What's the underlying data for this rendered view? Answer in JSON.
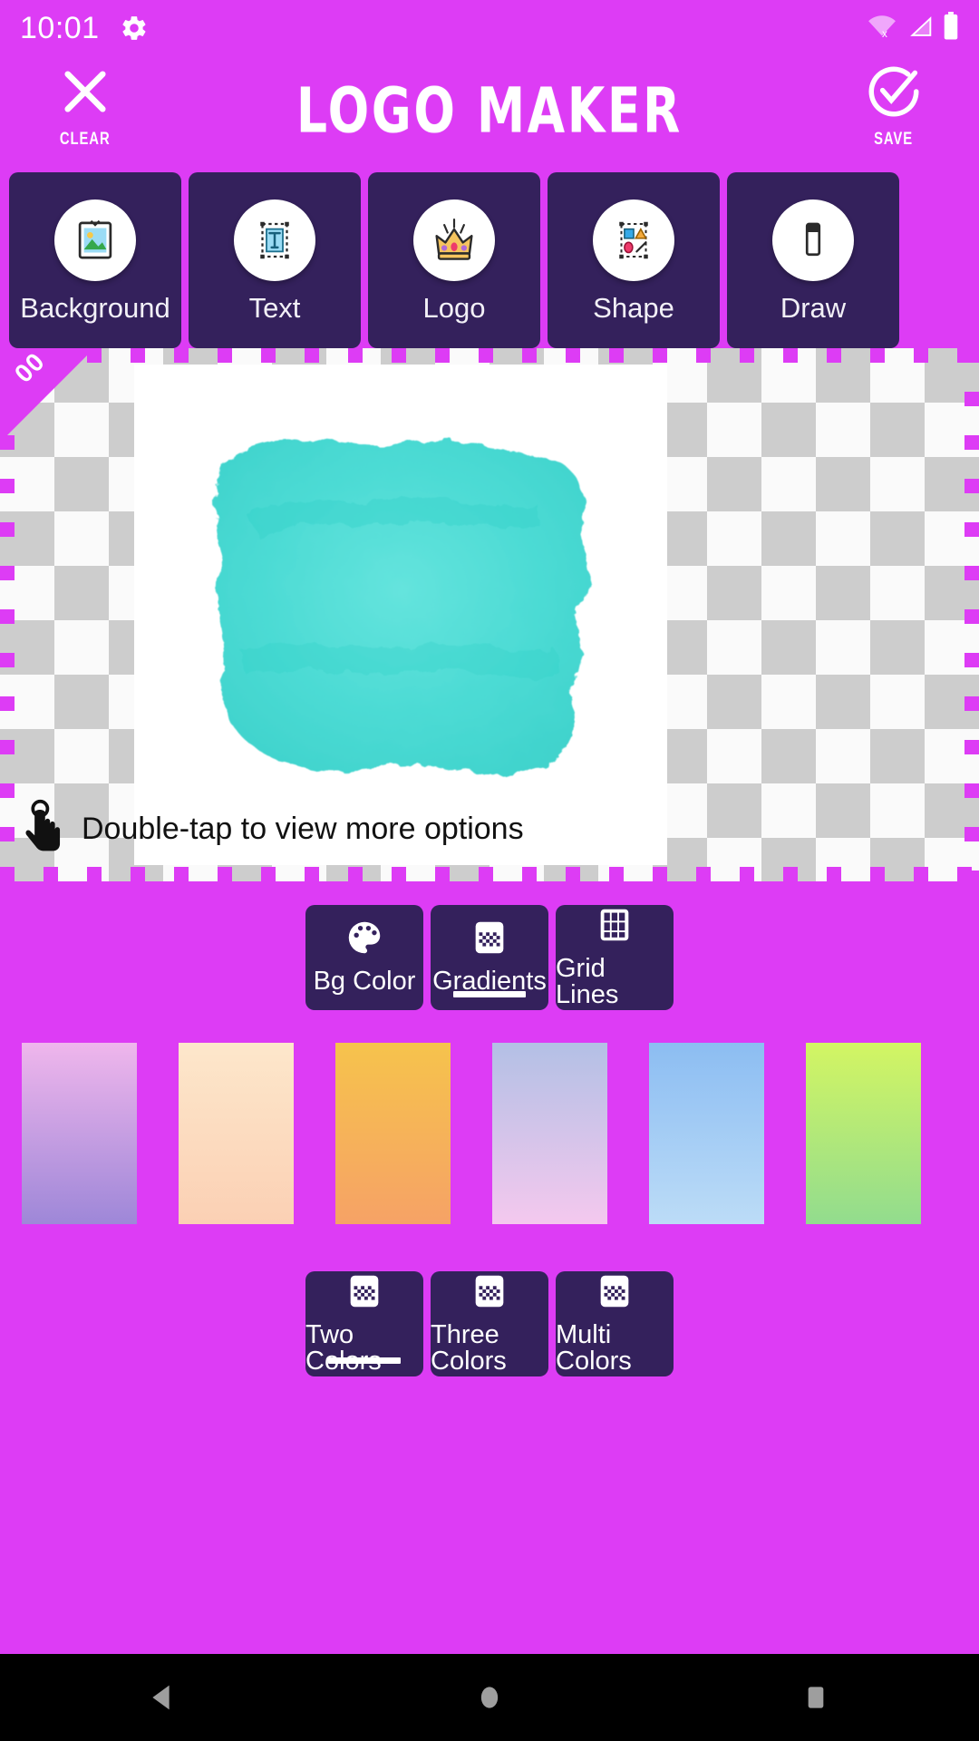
{
  "status_bar": {
    "time": "10:01",
    "icons": [
      "gear-icon",
      "wifi-off-icon",
      "signal-icon",
      "battery-icon"
    ]
  },
  "app_bar": {
    "title": "LOGO MAKER",
    "clear_label": "CLEAR",
    "save_label": "SAVE",
    "clear_icon": "close-x-icon",
    "save_icon": "check-circle-icon"
  },
  "categories": [
    {
      "label": "Background",
      "icon": "image-frame-icon"
    },
    {
      "label": "Text",
      "icon": "text-box-icon"
    },
    {
      "label": "Logo",
      "icon": "crown-icon"
    },
    {
      "label": "Shape",
      "icon": "shapes-icon"
    },
    {
      "label": "Draw",
      "icon": "draw-icon"
    }
  ],
  "canvas": {
    "corner_badge": "00",
    "hint_text": "Double-tap to view more options",
    "hint_icon": "double-tap-hand-icon",
    "artboard_bg": "#FFFFFF",
    "watercolor_color": "#3FD9D1"
  },
  "bg_modes": [
    {
      "label": "Bg Color",
      "icon": "palette-icon",
      "selected": false
    },
    {
      "label": "Gradients",
      "icon": "checker-gradient-icon",
      "selected": true
    },
    {
      "label": "Grid Lines",
      "icon": "grid-icon",
      "selected": false
    }
  ],
  "gradients": [
    {
      "name": "pink-purple",
      "from": "#EFB6EC",
      "to": "#9E87D8"
    },
    {
      "name": "cream-peach",
      "from": "#FDE7CB",
      "to": "#FBD0B4"
    },
    {
      "name": "yellow-orange",
      "from": "#F6C34C",
      "to": "#F6A266"
    },
    {
      "name": "blue-pink",
      "from": "#B3C0E5",
      "to": "#F4C8EE"
    },
    {
      "name": "blue-lightblue",
      "from": "#8CBDF2",
      "to": "#BCDCF7"
    },
    {
      "name": "yellow-green",
      "from": "#D3F563",
      "to": "#92DC8E"
    }
  ],
  "color_count_modes": [
    {
      "label": "Two Colors",
      "icon": "checker-gradient-icon",
      "selected": true
    },
    {
      "label": "Three Colors",
      "icon": "checker-gradient-icon",
      "selected": false
    },
    {
      "label": "Multi Colors",
      "icon": "checker-gradient-icon",
      "selected": false
    }
  ],
  "nav_bar": {
    "back": "back-triangle-icon",
    "home": "home-circle-icon",
    "recents": "recents-square-icon"
  },
  "theme": {
    "accent": "#DD3CF5",
    "card": "#34215C",
    "white": "#FFFFFF",
    "nav_bg": "#000000"
  }
}
